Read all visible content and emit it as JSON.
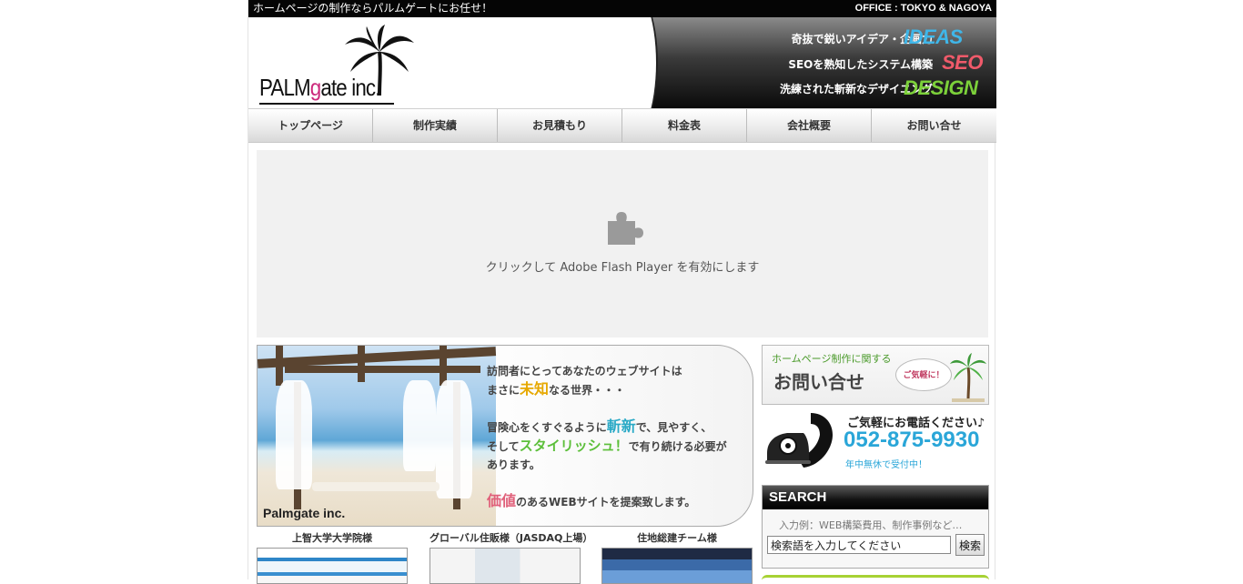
{
  "top_strip": {
    "left_text": "ホームページの制作ならパルムゲートにお任せ！",
    "right_text": "OFFICE : TOKYO & NAGOYA"
  },
  "header": {
    "logo_text_1": "PALM",
    "logo_text_g": "g",
    "logo_text_2": "ate inc.",
    "slogans": [
      {
        "text": "奇抜で鋭いアイデア・企画力",
        "word": "IDEAS",
        "color": "#3fb6e8"
      },
      {
        "text": "SEOを熟知したシステム構築",
        "word": "SEO",
        "color": "#f05a6a"
      },
      {
        "text": "洗練された斬新なデザイニング",
        "word": "DESIGN",
        "color": "#7cd13a"
      }
    ]
  },
  "nav": {
    "items": [
      "トップページ",
      "制作実績",
      "お見積もり",
      "料金表",
      "会社概要",
      "お問い合せ"
    ]
  },
  "flash": {
    "message": "クリックして Adobe Flash Player を有効にします"
  },
  "hero": {
    "line1": "訪問者にとってあなたのウェブサイトは",
    "line2_pre": "まさに",
    "line2_hl": "未知",
    "line2_post": "なる世界・・・",
    "line3_pre": "冒険心をくすぐるように",
    "line3_hl": "斬新",
    "line3_post": "で、見やすく、",
    "line4_pre": "そして",
    "line4_hl": "スタイリッシュ！",
    "line4_post": "で有り続ける必要が",
    "line5": "あります。",
    "line6_hl": "価値",
    "line6_post": "のあるWEBサイトを提案致します。",
    "brand": "Palmgate inc."
  },
  "works": [
    {
      "label": "上智大学大学院様"
    },
    {
      "label": "グローバル住販様（JASDAQ上場）"
    },
    {
      "label": "住地総建チーム様"
    }
  ],
  "sidebar": {
    "contact_small": "ホームページ制作に関する",
    "contact_big": "お問い合せ",
    "contact_bubble": "ご気軽に！",
    "phone_label": "ご気軽にお電話ください♪",
    "phone_number": "052-875-9930",
    "phone_note": "年中無休で受付中！",
    "search_title": "SEARCH",
    "search_hint": "入力例：WEB構築費用、制作事例など…",
    "search_value": "検索語を入力してください",
    "search_button": "検索"
  },
  "colors": {
    "accent_blue": "#2aa6d8",
    "brand_pink": "#cc2a7c",
    "green": "#a7d233"
  }
}
